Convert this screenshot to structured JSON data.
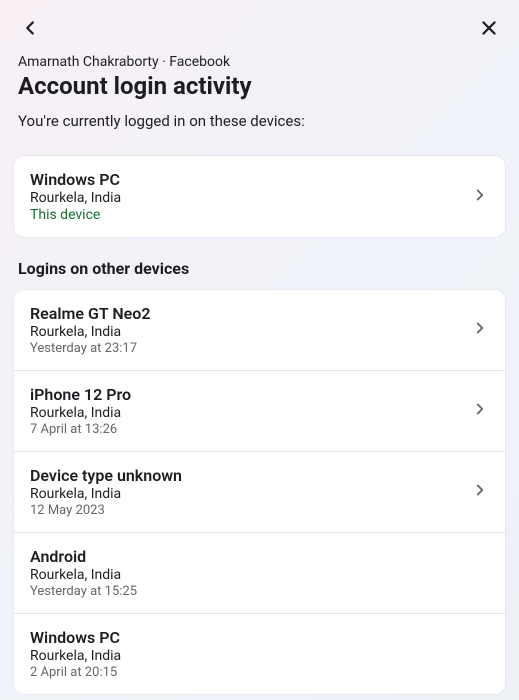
{
  "breadcrumb": "Amarnath Chakraborty · Facebook",
  "title": "Account login activity",
  "subtitle": "You're currently logged in on these devices:",
  "current_device": {
    "name": "Windows PC",
    "location": "Rourkela, India",
    "badge": "This device"
  },
  "section_title": "Logins on other devices",
  "other_devices": [
    {
      "name": "Realme GT Neo2",
      "location": "Rourkela, India",
      "time": "Yesterday at 23:17",
      "chevron": true
    },
    {
      "name": "iPhone 12 Pro",
      "location": "Rourkela, India",
      "time": "7 April at 13:26",
      "chevron": true
    },
    {
      "name": "Device type unknown",
      "location": "Rourkela, India",
      "time": "12 May 2023",
      "chevron": true
    },
    {
      "name": "Android",
      "location": "Rourkela, India",
      "time": "Yesterday at 15:25",
      "chevron": false
    },
    {
      "name": "Windows PC",
      "location": "Rourkela, India",
      "time": "2 April at 20:15",
      "chevron": false
    }
  ]
}
